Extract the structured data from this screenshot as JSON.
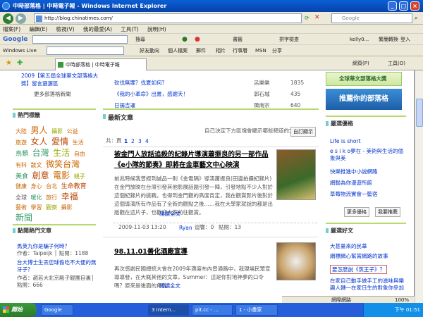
{
  "window": {
    "title": "中時部落格 | 中時電子報 - Windows Internet Explorer"
  },
  "address": {
    "url": "http://blog.chinatimes.com/",
    "search_placeholder": "Google"
  },
  "menu": [
    "檔案(F)",
    "編輯(E)",
    "檢視(V)",
    "我的最愛(A)",
    "工具(T)",
    "說明(H)"
  ],
  "google_toolbar": {
    "label": "Google",
    "search_btn": "搜尋",
    "bookmarks": "書籤",
    "spell": "拼字檢查",
    "user": "kelly0...",
    "translate": "繁簡轉換",
    "login": "登入"
  },
  "live_toolbar": {
    "label": "Windows Live",
    "items": [
      "好友動向",
      "個人檔案",
      "郵件",
      "相片",
      "行事曆",
      "MSN",
      "分享"
    ]
  },
  "tab": {
    "title": "中時部落格 | 中時電子報",
    "page_menu": "網頁(P)",
    "tools_menu": "工具(O)"
  },
  "top": {
    "banner_line1": "2009【第五屆全球華文部落格大",
    "banner_line2": "獎】留言選選區",
    "more_link": "更多部落格新聞",
    "table": [
      {
        "title": "砍伐無罪？伐夏如何？",
        "author": "呂樂樂",
        "count": "1835"
      },
      {
        "title": "《我的小革命》出書，感謝天！",
        "author": "郭石城",
        "count": "435"
      },
      {
        "title": "日揚吉運",
        "author": "陳南宗",
        "count": "640"
      }
    ],
    "right_banner1": "全球華文部落格大獎",
    "right_banner2": "推薦你的部落格"
  },
  "left": {
    "hot_tags_title": "熱門標籤",
    "tags": [
      "大陸",
      "男人",
      "攝影",
      "公益",
      "旅遊",
      "女人",
      "愛情",
      "生活",
      "鳥類",
      "台灣",
      "生活",
      "自由",
      "有科",
      "散文",
      "微笑台灣",
      "美食",
      "創意",
      "電影",
      "親子",
      "健康",
      "身心",
      "台北",
      "生命教育",
      "全球",
      "暖化",
      "旅行",
      "幸福",
      "藝術",
      "學習",
      "觀察",
      "攝影",
      "新聞"
    ],
    "hot_comments_title": "點閱熱門文章",
    "hot_items": [
      {
        "title": "馬英九你是騙子何時？",
        "meta": "作者：Taipeijk │ 點閱：1188"
      },
      {
        "title": "台大博士生丟您球偷吃不大便的無牙子？",
        "meta": "作者：趙若大北京殿子餛團目裏│ 點閱：666"
      }
    ]
  },
  "main": {
    "section_title": "最新文章",
    "customize_hint": "自己決定下方區塊會顯示哪些頻道的文章",
    "customize_btn": "自訂顯示",
    "pagination": [
      "共：頁",
      "1",
      "2",
      "3",
      "4"
    ],
    "articles": [
      {
        "title": "被金門人放話追殺的紀錄片導演蕭振良的另一部作品《e小隊的節奏》即將在金車藝文中心映演",
        "summary": "前兆時候我曾經到誠品一則《金電隔》導演蕭振良(田邊拍攝紀錄片)在金門放映在台灣引發其他影展話題引發一陣，引發地點不少人對於這個紀錄片的挑戰，也得到金門觀的高度肯定，我在觀賞影片後對於這個導演所有作品有了全新的觀點之後……我在大學家就說的都是出版觀在這片子，也歡迎大家前往觀賞。",
        "meta_date": "2009-11-03 13:20",
        "meta_author": "Ryan",
        "meta_reply": "迴響：0",
        "meta_views": "點閱：13",
        "read_more": "閱讀全文"
      },
      {
        "title": "98.11.01善化酒廠宣導",
        "summary": "再次感謝民國總統大會在2009年適度布內曾通路中，我現場民眾宣導導發，在大概其他的文章，Summer：這是你對地神夢的口令嗎？原來是後面的角色……",
        "read_more": "閱讀全文"
      }
    ]
  },
  "right": {
    "recommend_title": "嚴選優格",
    "recommend_items": [
      "Life is short",
      "e s i k o夢在 - 美術與生活的個象與美",
      "快樂推進中小說網路",
      "網聯為你漫遊所館",
      "草莓物流實會一籃宿"
    ],
    "more_btn": "更多優格",
    "my_btn": "我要推薦",
    "good_title": "嚴選好文",
    "good_items": [
      "大甚量來的民華",
      "網標網心幫賞網路的故事",
      "要怎麼說《蒸王子》？",
      "在家自己動手做手工的滋味與樂趣人轉一在家日生的對象你參加"
    ]
  },
  "status": {
    "zone": "網際網路",
    "zoom": "100%",
    "start": "開始",
    "clock": "下午 01:51"
  },
  "taskbar": [
    "Google",
    "3 Intern...",
    "pit.cc - ...",
    "1 - 小畫家"
  ]
}
